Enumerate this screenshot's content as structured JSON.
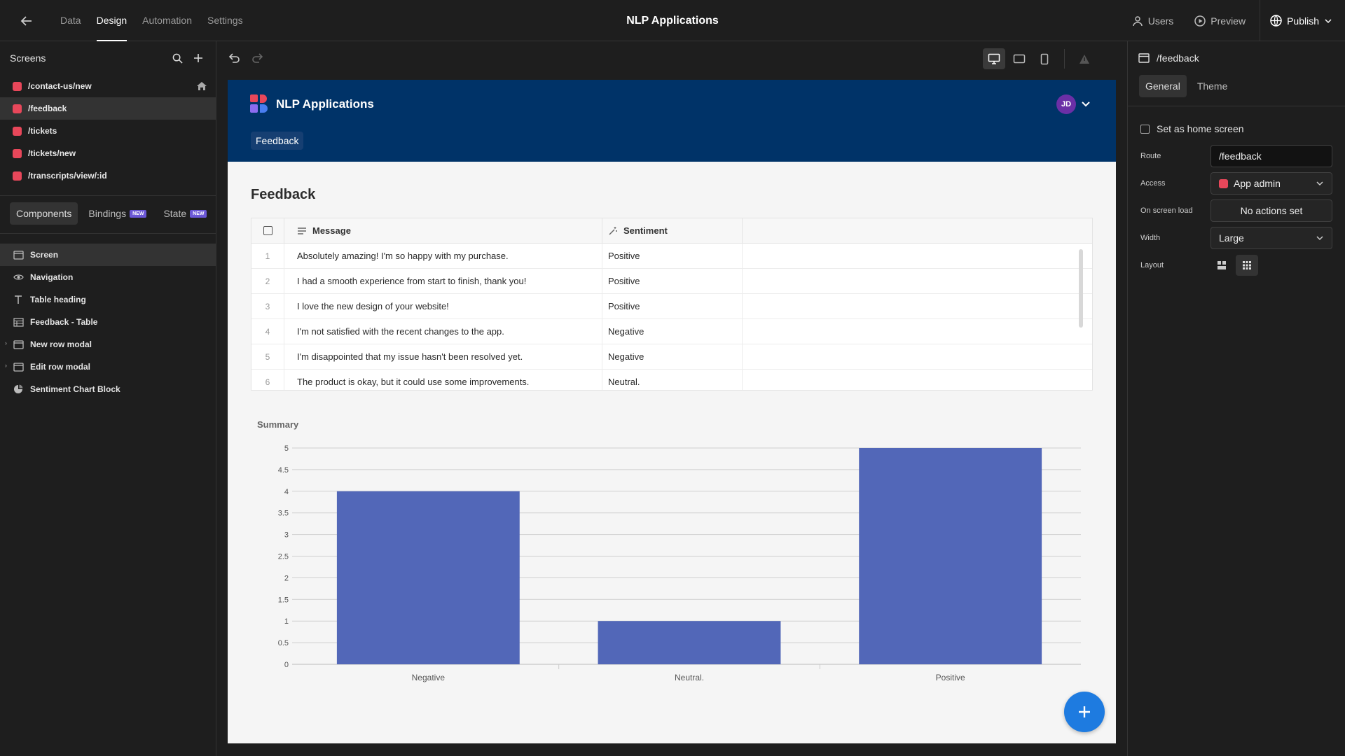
{
  "topbar": {
    "tabs": [
      {
        "label": "Data"
      },
      {
        "label": "Design"
      },
      {
        "label": "Automation"
      },
      {
        "label": "Settings"
      }
    ],
    "app_title": "NLP Applications",
    "users_label": "Users",
    "preview_label": "Preview",
    "publish_label": "Publish"
  },
  "left_panel": {
    "screens_title": "Screens",
    "screens": [
      {
        "route": "/contact-us/new"
      },
      {
        "route": "/feedback"
      },
      {
        "route": "/tickets"
      },
      {
        "route": "/tickets/new"
      },
      {
        "route": "/transcripts/view/:id"
      }
    ],
    "tabs": [
      {
        "label": "Components"
      },
      {
        "label": "Bindings",
        "badge": "NEW"
      },
      {
        "label": "State",
        "badge": "NEW"
      }
    ],
    "components": [
      {
        "label": "Screen",
        "icon": "screen-icon"
      },
      {
        "label": "Navigation",
        "icon": "eye-icon"
      },
      {
        "label": "Table heading",
        "icon": "text-icon"
      },
      {
        "label": "Feedback - Table",
        "icon": "table-icon"
      },
      {
        "label": "New row modal",
        "icon": "modal-icon"
      },
      {
        "label": "Edit row modal",
        "icon": "modal-icon"
      },
      {
        "label": "Sentiment Chart Block",
        "icon": "chart-icon"
      }
    ]
  },
  "app": {
    "name": "NLP Applications",
    "avatar": "JD",
    "nav_link": "Feedback",
    "heading": "Feedback",
    "table": {
      "columns": [
        "Message",
        "Sentiment"
      ],
      "rows": [
        {
          "n": "1",
          "message": "Absolutely amazing! I'm so happy with my purchase.",
          "sentiment": "Positive"
        },
        {
          "n": "2",
          "message": "I had a smooth experience from start to finish, thank you!",
          "sentiment": "Positive"
        },
        {
          "n": "3",
          "message": "I love the new design of your website!",
          "sentiment": "Positive"
        },
        {
          "n": "4",
          "message": "I'm not satisfied with the recent changes to the app.",
          "sentiment": "Negative"
        },
        {
          "n": "5",
          "message": "I'm disappointed that my issue hasn't been resolved yet.",
          "sentiment": "Negative"
        },
        {
          "n": "6",
          "message": "The product is okay, but it could use some improvements.",
          "sentiment": "Neutral."
        }
      ]
    },
    "colors": {
      "nav": "#003368",
      "bar": "#5267b8",
      "fab": "#1e7be0"
    }
  },
  "chart_data": {
    "type": "bar",
    "title": "Summary",
    "categories": [
      "Negative",
      "Neutral.",
      "Positive"
    ],
    "values": [
      4,
      1,
      5
    ],
    "ylim": [
      0,
      5
    ],
    "yticks": [
      "0",
      "0.5",
      "1",
      "1.5",
      "2",
      "2.5",
      "3",
      "3.5",
      "4",
      "4.5",
      "5"
    ],
    "xlabel": "",
    "ylabel": "",
    "grid": true
  },
  "right_panel": {
    "title": "/feedback",
    "tabs": [
      {
        "label": "General"
      },
      {
        "label": "Theme"
      }
    ],
    "home_checkbox_label": "Set as home screen",
    "route_label": "Route",
    "route_value": "/feedback",
    "access_label": "Access",
    "access_value": "App admin",
    "load_label": "On screen load",
    "load_value": "No actions set",
    "width_label": "Width",
    "width_value": "Large",
    "layout_label": "Layout"
  }
}
